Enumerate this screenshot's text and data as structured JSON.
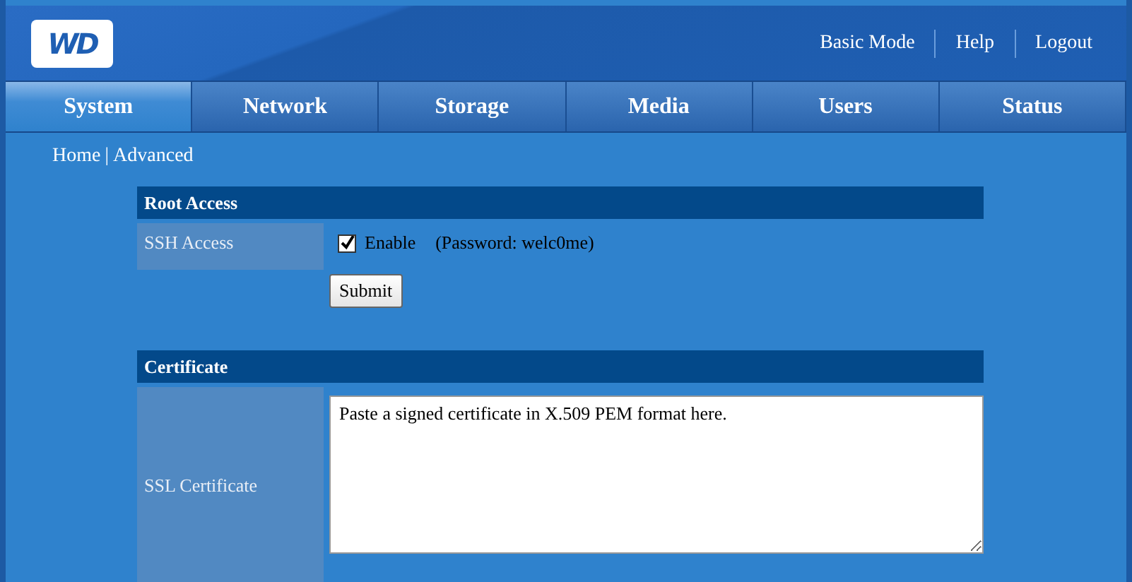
{
  "header": {
    "logo": "WD",
    "links": [
      "Basic Mode",
      "Help",
      "Logout"
    ]
  },
  "tabs": [
    {
      "label": "System",
      "selected": true
    },
    {
      "label": "Network",
      "selected": false
    },
    {
      "label": "Storage",
      "selected": false
    },
    {
      "label": "Media",
      "selected": false
    },
    {
      "label": "Users",
      "selected": false
    },
    {
      "label": "Status",
      "selected": false
    }
  ],
  "breadcrumb": {
    "items": [
      "Home",
      "Advanced"
    ],
    "separator": "|"
  },
  "root_access": {
    "title": "Root Access",
    "label": "SSH Access",
    "checkbox": {
      "label": "Enable",
      "checked": true
    },
    "note": "(Password: welc0me)",
    "button": "Submit"
  },
  "certificate": {
    "title": "Certificate",
    "label": "SSL Certificate",
    "value": "Paste a signed certificate in X.509 PEM format here."
  }
}
